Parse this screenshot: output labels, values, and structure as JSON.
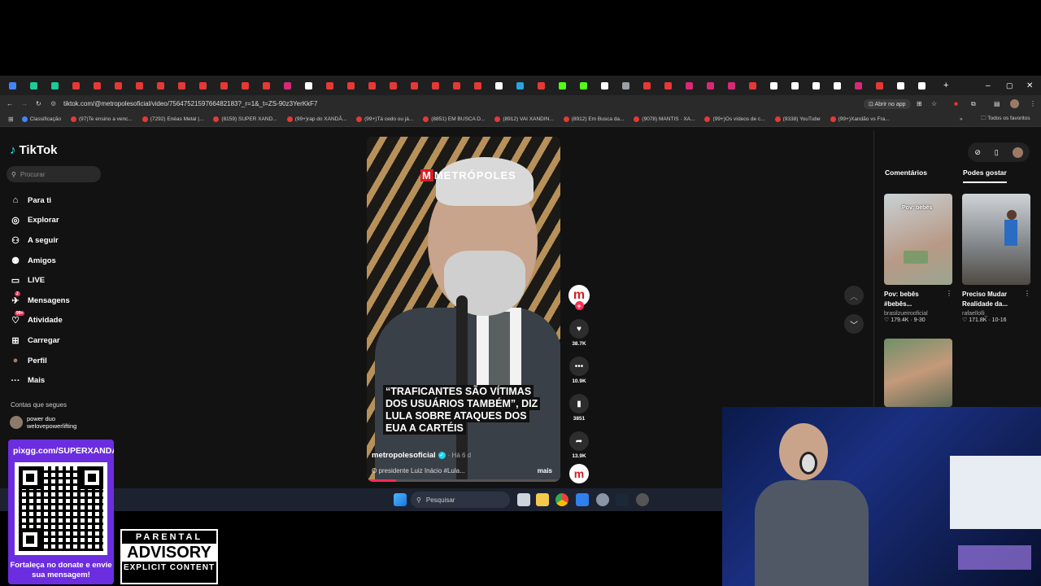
{
  "browser": {
    "url": "tiktok.com/@metropolesoficial/video/7564752159766482183?_r=1&_t=ZS-90z3YerKkF7",
    "open_in_app": "Abrir no app",
    "favorites": "Todos os favoritos",
    "bookmarks": [
      "Classificação",
      "(97)Te ensino a venc...",
      "(7292) Enéas Metal |...",
      "(8159) SUPER XAND...",
      "(99+)rap do XANDÃ...",
      "(99+)Tá cedo ou já...",
      "(8851) EM BUSCA D...",
      "(8912) VAI XANDIN...",
      "(8912) Em Busca da...",
      "(9078) MANTIS · XA...",
      "(99+)Os vídeos de c...",
      "(9338) YouTube",
      "(99+)Xandão vs Fra..."
    ]
  },
  "sidebar": {
    "logo": "TikTok",
    "search_placeholder": "Procurar",
    "items": [
      {
        "label": "Para ti",
        "icon": "home-icon"
      },
      {
        "label": "Explorar",
        "icon": "compass-icon"
      },
      {
        "label": "A seguir",
        "icon": "user-plus-icon"
      },
      {
        "label": "Amigos",
        "icon": "friends-icon"
      },
      {
        "label": "LIVE",
        "icon": "live-icon"
      },
      {
        "label": "Mensagens",
        "icon": "message-icon",
        "badge": "2"
      },
      {
        "label": "Atividade",
        "icon": "activity-icon",
        "badge": "99+"
      },
      {
        "label": "Carregar",
        "icon": "upload-icon"
      },
      {
        "label": "Perfil",
        "icon": "avatar-icon"
      },
      {
        "label": "Mais",
        "icon": "more-icon"
      }
    ],
    "following_title": "Contas que segues",
    "following": [
      {
        "name": "power duo",
        "handle": "welovepowerlifting"
      }
    ]
  },
  "video": {
    "brand": "METRÓPOLES",
    "headline": "“TRAFICANTES SÃO VÍTIMAS DOS USUÁRIOS TAMBÉM”, DIZ LULA SOBRE ATAQUES DOS EUA A CARTÉIS",
    "author": "metropolesoficial",
    "age": "· Há 6 d",
    "caption": "O presidente Luiz Inácio #Lula...",
    "more": "mais",
    "progress": 0.15
  },
  "actions": {
    "likes": "38.7K",
    "comments": "10.9K",
    "saves": "3851",
    "shares": "13.9K"
  },
  "right_panel": {
    "tabs": [
      "Comentários",
      "Podes gostar"
    ],
    "cards": [
      {
        "title": "Pov: bebês #bebês...",
        "user": "brasilzueirooficial",
        "stats": "♡ 179.4K · 9-30",
        "overlay": "Pov: bebês"
      },
      {
        "title": "Preciso Mudar Realidade da...",
        "user": "rafaellolli_",
        "stats": "♡ 171.8K · 10-16"
      }
    ]
  },
  "taskbar": {
    "search": "Pesquisar"
  },
  "overlay": {
    "qr_url": "pixgg.com/SUPERXANDAO",
    "qr_message": "Fortaleça no donate e envie sua mensagem!",
    "advisory": {
      "l1": "PARENTAL",
      "l2": "ADVISORY",
      "l3": "EXPLICIT CONTENT"
    }
  }
}
